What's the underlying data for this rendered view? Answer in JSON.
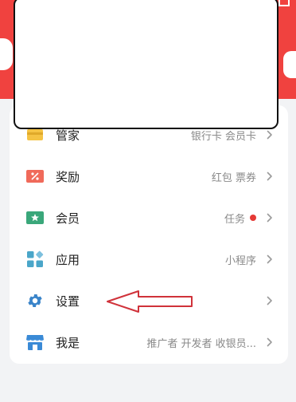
{
  "rows": [
    {
      "label": "管家",
      "detail": "银行卡 会员卡",
      "icon": "wallet-icon",
      "icon_color": "#f5c344"
    },
    {
      "label": "奖励",
      "detail": "红包 票券",
      "icon": "coupon-icon",
      "icon_color": "#f06a5a"
    },
    {
      "label": "会员",
      "detail": "任务",
      "icon": "member-star-icon",
      "icon_color": "#3aa77a",
      "badge_color": "#e53935"
    },
    {
      "label": "应用",
      "detail": "小程序",
      "icon": "apps-grid-icon",
      "icon_color": "#4aa6c9"
    },
    {
      "label": "设置",
      "detail": "",
      "icon": "gear-icon",
      "icon_color": "#3a84c9"
    },
    {
      "label": "我是",
      "detail": "推广者 开发者 收银员...",
      "icon": "store-icon",
      "icon_color": "#3a8ad6"
    }
  ],
  "colors": {
    "header": "#f0423f",
    "annotation_arrow": "#d0323a"
  }
}
